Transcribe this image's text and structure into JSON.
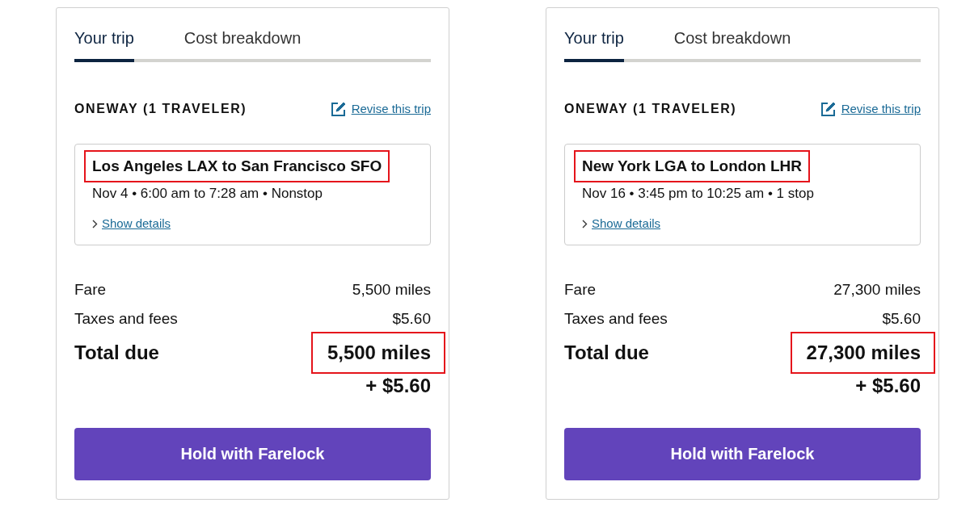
{
  "cards": [
    {
      "tabs": [
        {
          "label": "Your trip",
          "selected": true
        },
        {
          "label": "Cost breakdown",
          "selected": false
        }
      ],
      "trip_type": "ONEWAY (1 TRAVELER)",
      "revise_link": "Revise this trip",
      "flight": {
        "route": "Los Angeles LAX to San Francisco SFO",
        "route_highlighted": true,
        "summary": "Nov 4 • 6:00 am to 7:28 am • Nonstop",
        "details_link": "Show details"
      },
      "lines": [
        {
          "label": "Fare",
          "value": "5,500 miles"
        },
        {
          "label": "Taxes and fees",
          "value": "$5.60"
        }
      ],
      "total": {
        "label": "Total due",
        "miles": "5,500 miles",
        "miles_highlighted": true,
        "cash": "+ $5.60"
      },
      "button": "Hold with Farelock"
    },
    {
      "tabs": [
        {
          "label": "Your trip",
          "selected": true
        },
        {
          "label": "Cost breakdown",
          "selected": false
        }
      ],
      "trip_type": "ONEWAY (1 TRAVELER)",
      "revise_link": "Revise this trip",
      "flight": {
        "route": "New York LGA to London LHR",
        "route_highlighted": true,
        "summary": "Nov 16 • 3:45 pm to 10:25 am • 1 stop",
        "details_link": "Show details"
      },
      "lines": [
        {
          "label": "Fare",
          "value": "27,300 miles"
        },
        {
          "label": "Taxes and fees",
          "value": "$5.60"
        }
      ],
      "total": {
        "label": "Total due",
        "miles": "27,300 miles",
        "miles_highlighted": true,
        "cash": "+ $5.60"
      },
      "button": "Hold with Farelock"
    }
  ]
}
